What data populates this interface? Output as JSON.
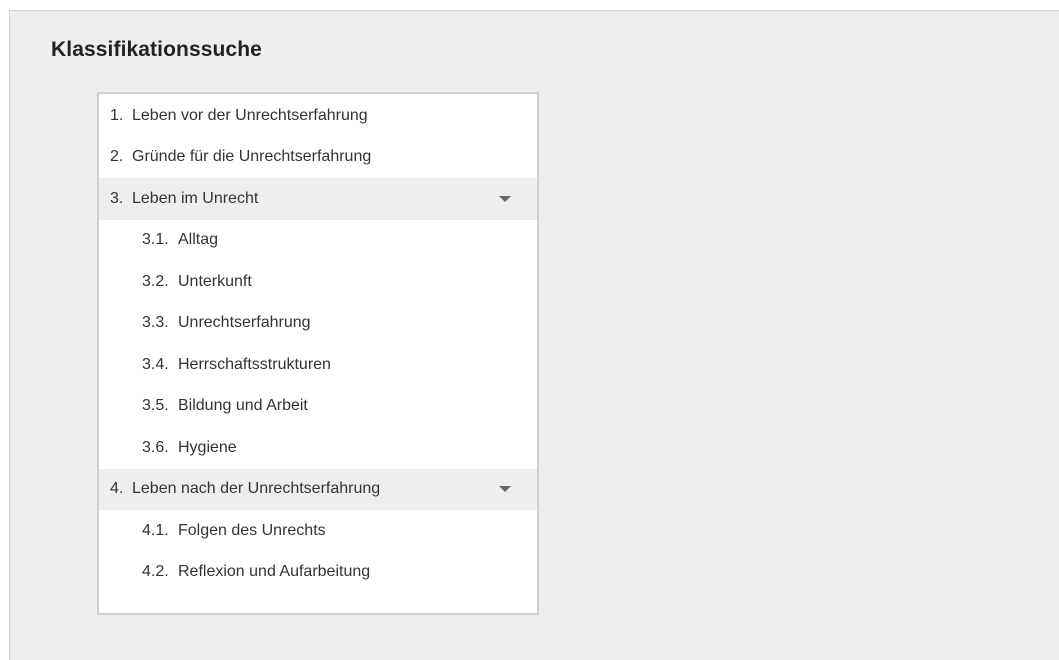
{
  "title": "Klassifikationssuche",
  "tree": {
    "items": [
      {
        "number": "1.",
        "label": "Leben vor der Unrechtserfahrung"
      },
      {
        "number": "2.",
        "label": "Gründe für die Unrechtserfahrung"
      },
      {
        "number": "3.",
        "label": "Leben im Unrecht",
        "expanded": true,
        "children": [
          {
            "number": "3.1.",
            "label": "Alltag"
          },
          {
            "number": "3.2.",
            "label": "Unterkunft"
          },
          {
            "number": "3.3.",
            "label": "Unrechtserfahrung"
          },
          {
            "number": "3.4.",
            "label": "Herrschaftsstrukturen"
          },
          {
            "number": "3.5.",
            "label": "Bildung und Arbeit"
          },
          {
            "number": "3.6.",
            "label": "Hygiene"
          }
        ]
      },
      {
        "number": "4.",
        "label": "Leben nach der Unrechtserfahrung",
        "expanded": true,
        "children": [
          {
            "number": "4.1.",
            "label": "Folgen des Unrechts"
          },
          {
            "number": "4.2.",
            "label": "Reflexion und Aufarbeitung"
          }
        ]
      }
    ]
  },
  "icons": {
    "expanded_caret": "caret-down-icon"
  }
}
